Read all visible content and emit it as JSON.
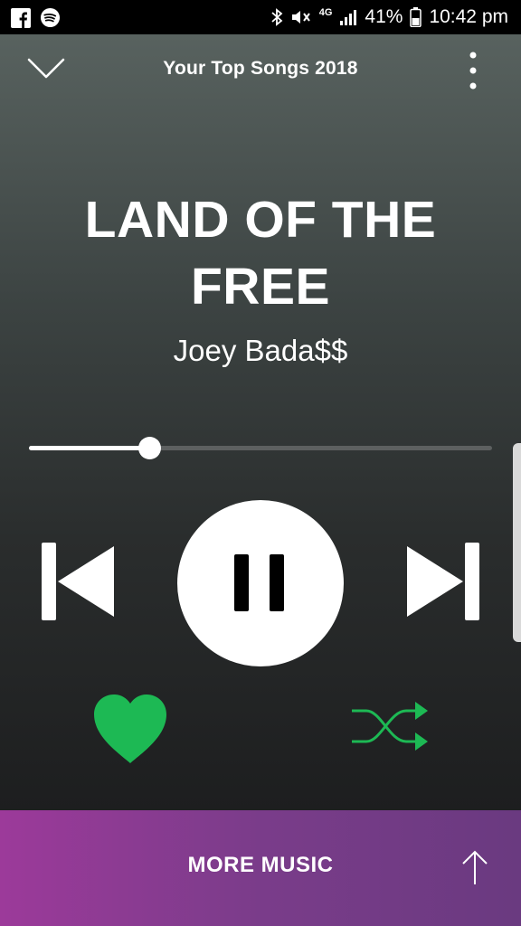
{
  "status_bar": {
    "battery": "41%",
    "time": "10:42 pm",
    "network": "4G",
    "icons": [
      "facebook-icon",
      "spotify-icon",
      "bluetooth-icon",
      "mute-icon",
      "signal-icon",
      "battery-icon"
    ]
  },
  "header": {
    "context_title": "Your Top Songs 2018",
    "icons": [
      "chevron-down-icon",
      "more-vertical-icon"
    ]
  },
  "track": {
    "title": "LAND OF THE FREE",
    "artist": "Joey Bada$$"
  },
  "playback": {
    "progress_fraction": 0.26,
    "state": "playing",
    "liked": true,
    "shuffle": true
  },
  "footer": {
    "more_music_label": "MORE MUSIC"
  },
  "colors": {
    "accent_green": "#1db954",
    "banner_purple": "#8a3c90"
  }
}
